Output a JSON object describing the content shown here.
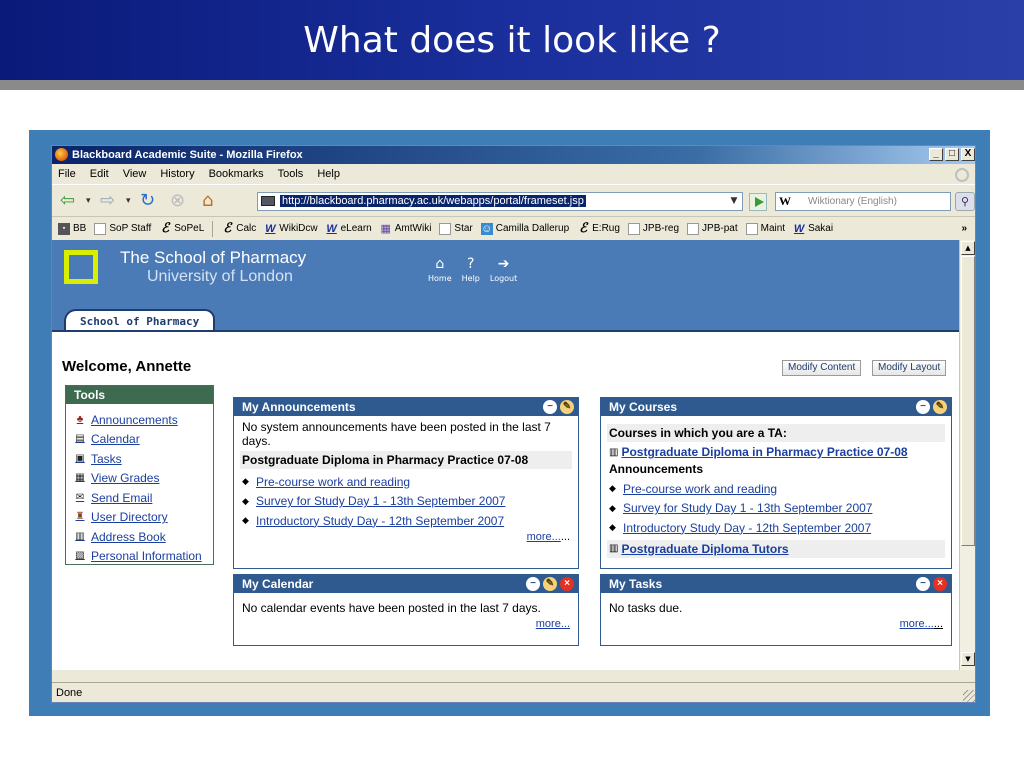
{
  "slide": {
    "title": "What does it look like ?"
  },
  "browser": {
    "window_title": "Blackboard Academic Suite - Mozilla Firefox",
    "window_buttons": [
      "_",
      "□",
      "X"
    ],
    "menu": [
      "File",
      "Edit",
      "View",
      "History",
      "Bookmarks",
      "Tools",
      "Help"
    ],
    "url": "http://blackboard.pharmacy.ac.uk/webapps/portal/frameset.jsp",
    "search_placeholder": "Wiktionary (English)",
    "search_engine": "W",
    "bookmarks": [
      {
        "label": "BB",
        "icon": "bb-icon"
      },
      {
        "label": "SoP Staff",
        "icon": "page-icon"
      },
      {
        "label": "SoPeL",
        "icon": "e-icon"
      },
      {
        "label": "Calc",
        "icon": "e-icon"
      },
      {
        "label": "WikiDcw",
        "icon": "w-icon"
      },
      {
        "label": "eLearn",
        "icon": "w-icon"
      },
      {
        "label": "AmtWiki",
        "icon": "grid-icon"
      },
      {
        "label": "Star",
        "icon": "page-icon"
      },
      {
        "label": "Camilla Dallerup",
        "icon": "face-icon"
      },
      {
        "label": "E:Rug",
        "icon": "e-icon"
      },
      {
        "label": "JPB-reg",
        "icon": "page-icon"
      },
      {
        "label": "JPB-pat",
        "icon": "page-icon"
      },
      {
        "label": "Maint",
        "icon": "page-icon"
      },
      {
        "label": "Sakai",
        "icon": "w-icon"
      }
    ],
    "bookmarks_more": "»",
    "status": "Done"
  },
  "site": {
    "school": "The School of Pharmacy",
    "university": "University of London",
    "topnav": [
      {
        "label": "Home",
        "icon": "home-icon"
      },
      {
        "label": "Help",
        "icon": "help-icon"
      },
      {
        "label": "Logout",
        "icon": "logout-icon"
      }
    ],
    "tab": "School of Pharmacy",
    "welcome": "Welcome, Annette",
    "modify_content": "Modify Content",
    "modify_layout": "Modify Layout"
  },
  "tools": {
    "title": "Tools",
    "items": [
      {
        "label": "Announcements",
        "icon": "announcement-icon"
      },
      {
        "label": "Calendar",
        "icon": "calendar-icon"
      },
      {
        "label": "Tasks",
        "icon": "tasks-icon"
      },
      {
        "label": "View Grades",
        "icon": "grades-icon"
      },
      {
        "label": "Send Email",
        "icon": "email-icon"
      },
      {
        "label": "User Directory",
        "icon": "user-directory-icon"
      },
      {
        "label": "Address Book",
        "icon": "address-book-icon"
      },
      {
        "label": "Personal Information",
        "icon": "personal-info-icon"
      }
    ]
  },
  "announcements": {
    "title": "My Announcements",
    "none_text": "No system announcements have been posted in the last 7 days.",
    "course": "Postgraduate Diploma in Pharmacy Practice 07-08",
    "items": [
      "Pre-course work and reading",
      "Survey for Study Day 1 - 13th September 2007",
      "Introductory Study Day - 12th September 2007"
    ],
    "more": "more...",
    "more_tail": "..."
  },
  "calendar": {
    "title": "My Calendar",
    "text": "No calendar events have been posted in the last 7 days.",
    "more": "more..."
  },
  "courses": {
    "title": "My Courses",
    "ta_heading": "Courses in which you are a TA:",
    "course": "Postgraduate Diploma in Pharmacy Practice 07-08",
    "ann_heading": "Announcements",
    "items": [
      "Pre-course work and reading",
      "Survey for Study Day 1 - 13th September 2007",
      "Introductory Study Day - 12th September 2007"
    ],
    "tutors": "Postgraduate Diploma Tutors"
  },
  "tasks": {
    "title": "My Tasks",
    "text": "No tasks due.",
    "more": "more...",
    "more_tail": "..."
  }
}
